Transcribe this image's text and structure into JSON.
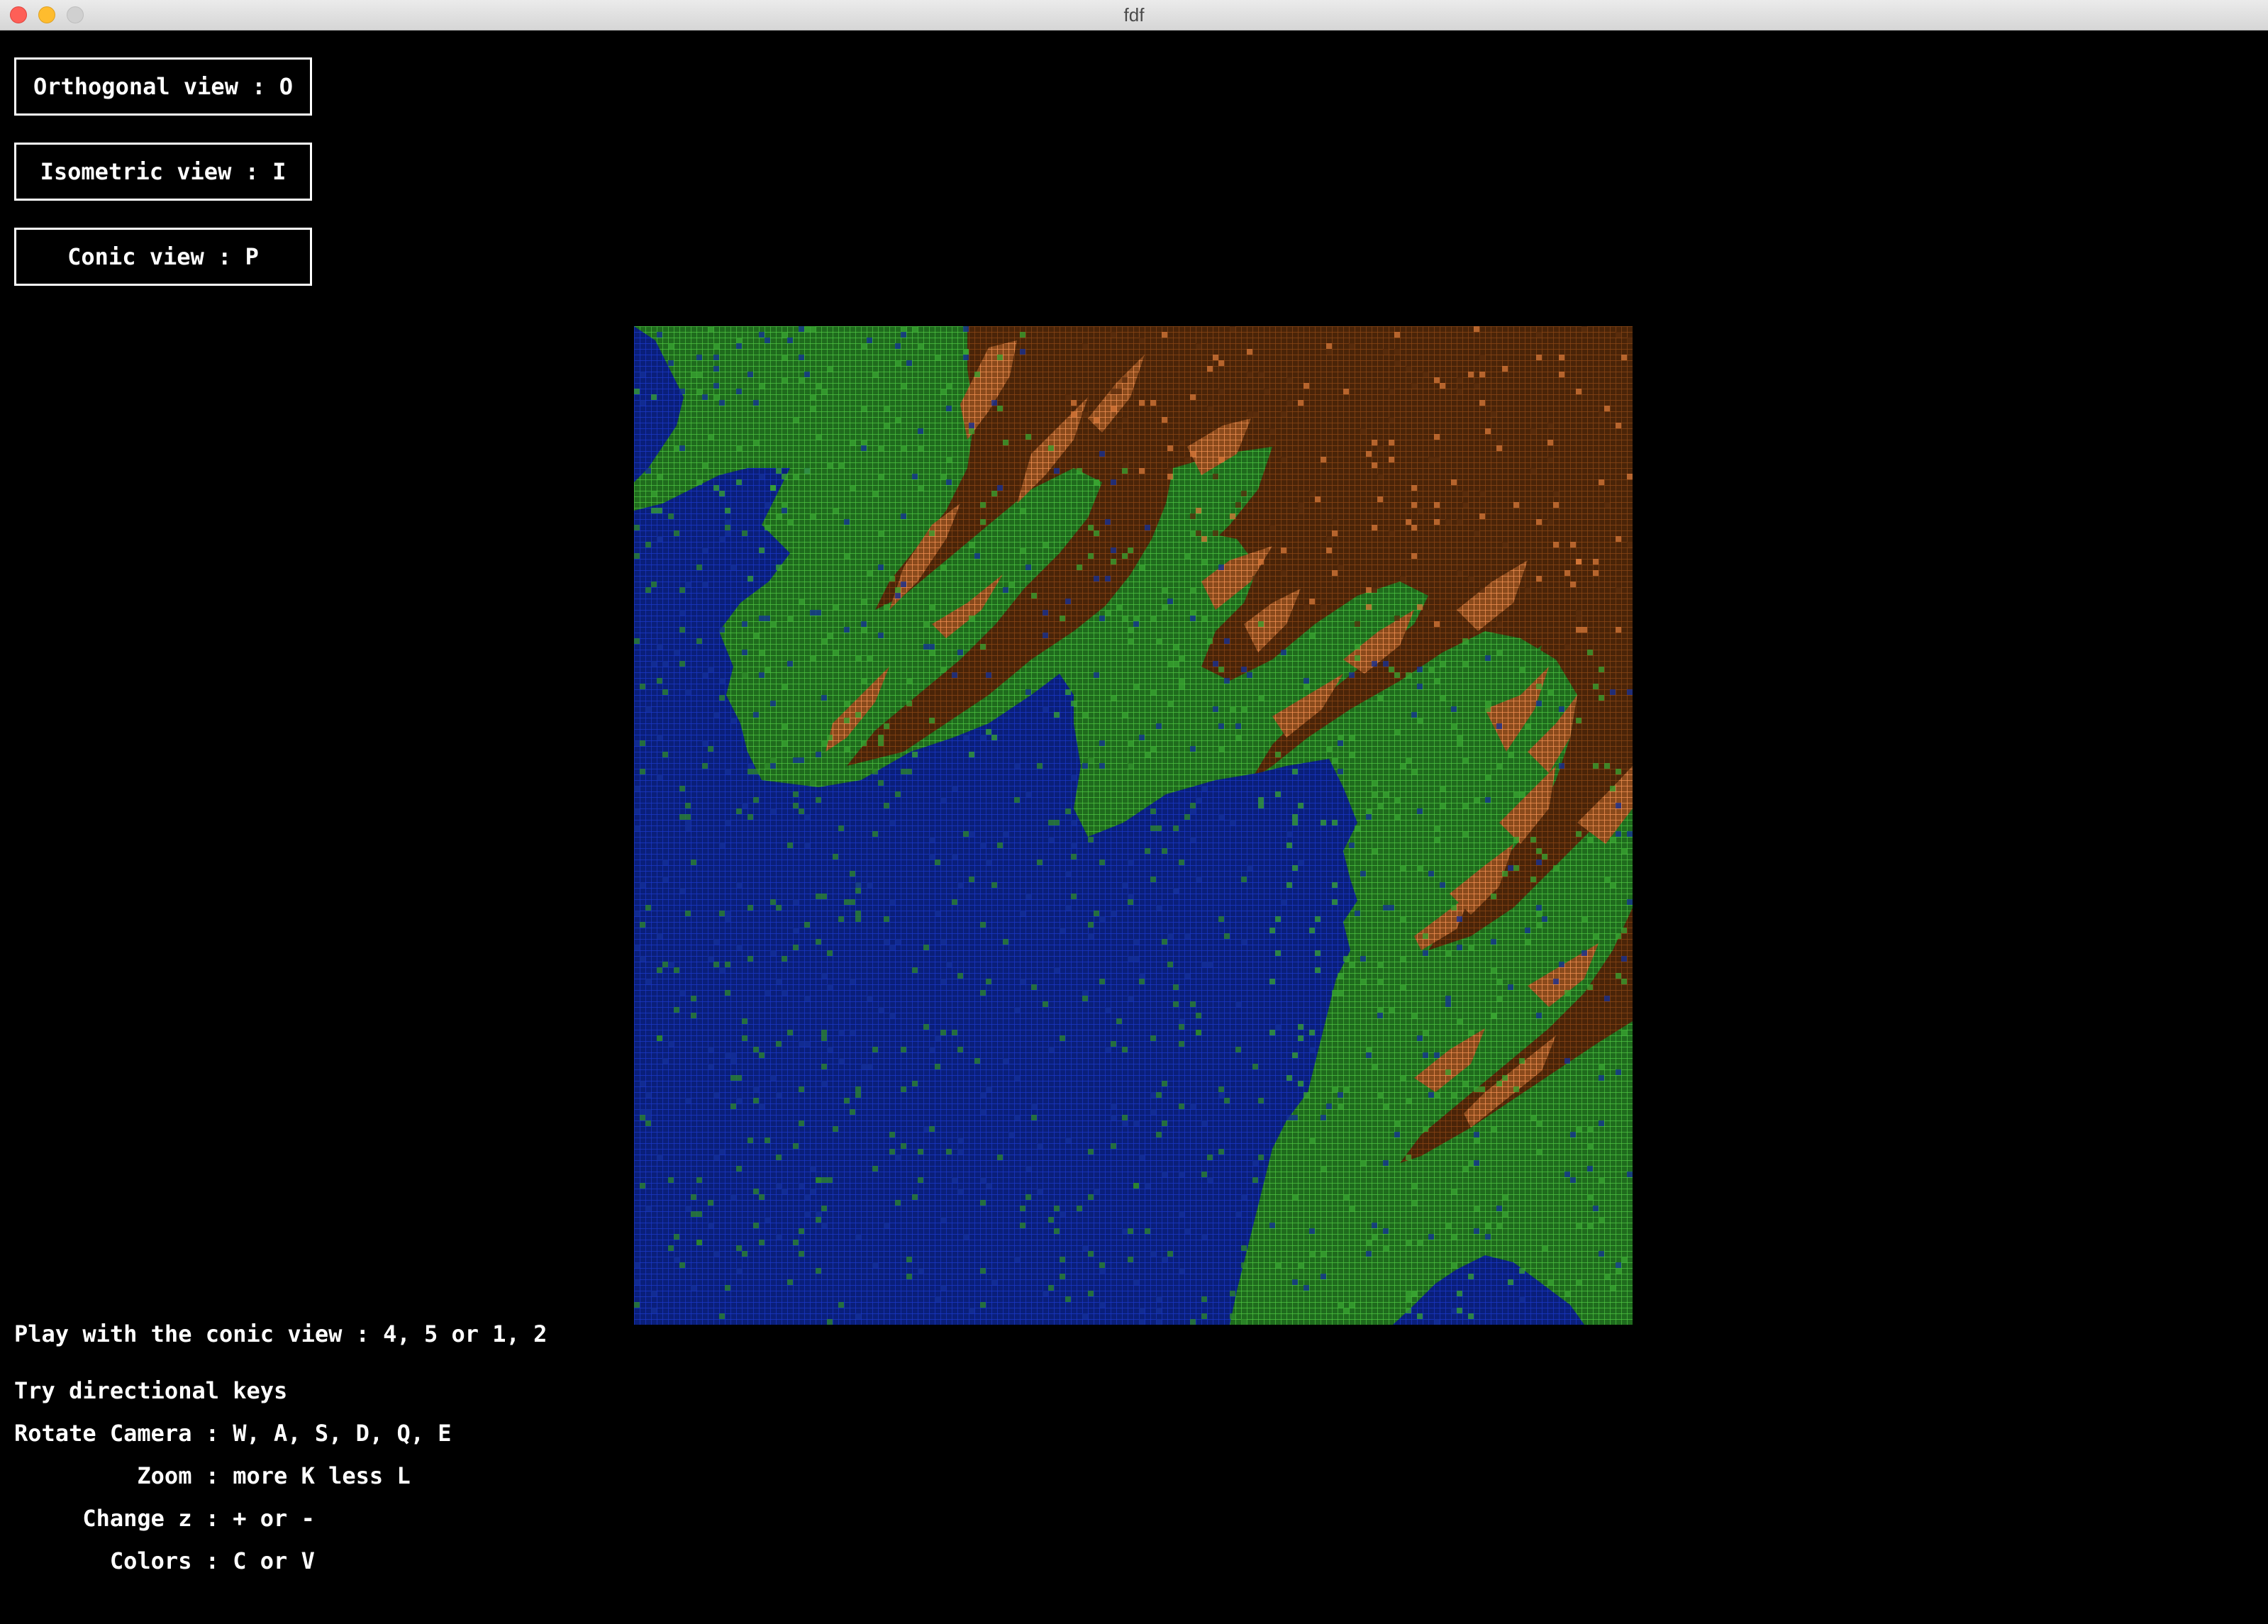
{
  "window": {
    "title": "fdf"
  },
  "buttons": {
    "orthogonal": "Orthogonal view : O",
    "isometric": "Isometric view : I",
    "conic": "Conic view : P"
  },
  "help": {
    "conic_play": "Play with the conic view : 4, 5 or 1, 2",
    "directional": "Try directional keys",
    "rotate": "Rotate Camera : W, A, S, D, Q, E",
    "zoom": "         Zoom : more K less L",
    "change_z": "     Change z : + or -",
    "colors": "       Colors : C or V"
  },
  "map": {
    "description_colors": {
      "water": "#0f2a9c",
      "land": "#2f8a2a",
      "mountain": "#7a3d10",
      "peak": "#d97a3a",
      "grid_green": "#3aa531"
    }
  }
}
